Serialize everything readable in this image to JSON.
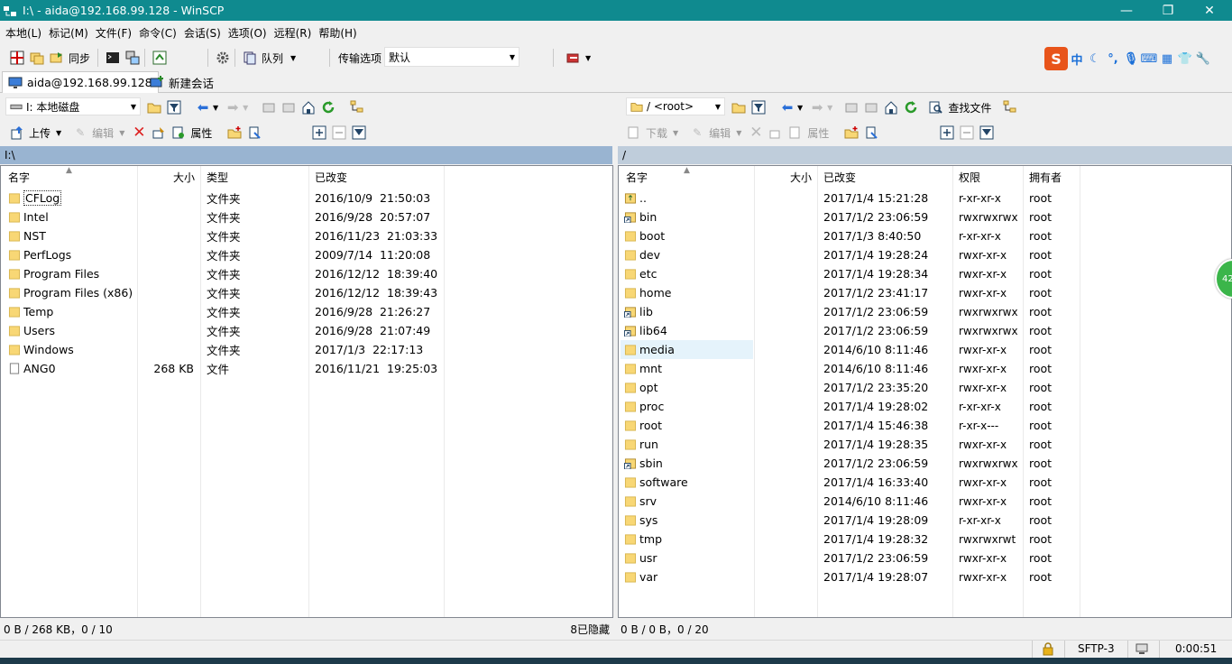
{
  "window": {
    "title": "I:\\ - aida@192.168.99.128 - WinSCP",
    "controls": {
      "minimize": "—",
      "restore": "❐",
      "close": "✕"
    }
  },
  "menu": [
    "本地(L)",
    "标记(M)",
    "文件(F)",
    "命令(C)",
    "会话(S)",
    "选项(O)",
    "远程(R)",
    "帮助(H)"
  ],
  "toolbar": {
    "sync_label": "同步",
    "queue_label": "队列",
    "transfer_options_label": "传输选项",
    "transfer_preset": "默认"
  },
  "ime": {
    "zh": "中"
  },
  "tabs": [
    {
      "label": "aida@192.168.99.128"
    },
    {
      "label": "新建会话"
    }
  ],
  "left": {
    "drive": "I: 本地磁盘",
    "upload_label": "上传",
    "edit_label": "编辑",
    "properties_label": "属性",
    "path": "I:\\",
    "columns": {
      "name": "名字",
      "size": "大小",
      "type": "类型",
      "changed": "已改变"
    },
    "files": [
      {
        "name": "CFLog",
        "size": "",
        "type": "文件夹",
        "changed": "2016/10/9  21:50:03",
        "kind": "folder"
      },
      {
        "name": "Intel",
        "size": "",
        "type": "文件夹",
        "changed": "2016/9/28  20:57:07",
        "kind": "folder"
      },
      {
        "name": "NST",
        "size": "",
        "type": "文件夹",
        "changed": "2016/11/23  21:03:33",
        "kind": "folder"
      },
      {
        "name": "PerfLogs",
        "size": "",
        "type": "文件夹",
        "changed": "2009/7/14  11:20:08",
        "kind": "folder"
      },
      {
        "name": "Program Files",
        "size": "",
        "type": "文件夹",
        "changed": "2016/12/12  18:39:40",
        "kind": "folder"
      },
      {
        "name": "Program Files (x86)",
        "size": "",
        "type": "文件夹",
        "changed": "2016/12/12  18:39:43",
        "kind": "folder"
      },
      {
        "name": "Temp",
        "size": "",
        "type": "文件夹",
        "changed": "2016/9/28  21:26:27",
        "kind": "folder"
      },
      {
        "name": "Users",
        "size": "",
        "type": "文件夹",
        "changed": "2016/9/28  21:07:49",
        "kind": "folder"
      },
      {
        "name": "Windows",
        "size": "",
        "type": "文件夹",
        "changed": "2017/1/3  22:17:13",
        "kind": "folder"
      },
      {
        "name": "ANG0",
        "size": "268 KB",
        "type": "文件",
        "changed": "2016/11/21  19:25:03",
        "kind": "file"
      }
    ],
    "status": "0 B / 268 KB，0 / 10",
    "hidden": "8已隐藏"
  },
  "right": {
    "path_select": "/ <root>",
    "find_files_label": "查找文件",
    "download_label": "下载",
    "edit_label": "编辑",
    "properties_label": "属性",
    "path": "/",
    "columns": {
      "name": "名字",
      "size": "大小",
      "changed": "已改变",
      "rights": "权限",
      "owner": "拥有者"
    },
    "files": [
      {
        "name": "..",
        "changed": "2017/1/4 15:21:28",
        "rights": "r-xr-xr-x",
        "owner": "root",
        "kind": "up"
      },
      {
        "name": "bin",
        "changed": "2017/1/2 23:06:59",
        "rights": "rwxrwxrwx",
        "owner": "root",
        "kind": "link"
      },
      {
        "name": "boot",
        "changed": "2017/1/3 8:40:50",
        "rights": "r-xr-xr-x",
        "owner": "root",
        "kind": "folder"
      },
      {
        "name": "dev",
        "changed": "2017/1/4 19:28:24",
        "rights": "rwxr-xr-x",
        "owner": "root",
        "kind": "folder"
      },
      {
        "name": "etc",
        "changed": "2017/1/4 19:28:34",
        "rights": "rwxr-xr-x",
        "owner": "root",
        "kind": "folder"
      },
      {
        "name": "home",
        "changed": "2017/1/2 23:41:17",
        "rights": "rwxr-xr-x",
        "owner": "root",
        "kind": "folder"
      },
      {
        "name": "lib",
        "changed": "2017/1/2 23:06:59",
        "rights": "rwxrwxrwx",
        "owner": "root",
        "kind": "link"
      },
      {
        "name": "lib64",
        "changed": "2017/1/2 23:06:59",
        "rights": "rwxrwxrwx",
        "owner": "root",
        "kind": "link"
      },
      {
        "name": "media",
        "changed": "2014/6/10 8:11:46",
        "rights": "rwxr-xr-x",
        "owner": "root",
        "kind": "folder",
        "hover": true
      },
      {
        "name": "mnt",
        "changed": "2014/6/10 8:11:46",
        "rights": "rwxr-xr-x",
        "owner": "root",
        "kind": "folder"
      },
      {
        "name": "opt",
        "changed": "2017/1/2 23:35:20",
        "rights": "rwxr-xr-x",
        "owner": "root",
        "kind": "folder"
      },
      {
        "name": "proc",
        "changed": "2017/1/4 19:28:02",
        "rights": "r-xr-xr-x",
        "owner": "root",
        "kind": "folder"
      },
      {
        "name": "root",
        "changed": "2017/1/4 15:46:38",
        "rights": "r-xr-x---",
        "owner": "root",
        "kind": "folder"
      },
      {
        "name": "run",
        "changed": "2017/1/4 19:28:35",
        "rights": "rwxr-xr-x",
        "owner": "root",
        "kind": "folder"
      },
      {
        "name": "sbin",
        "changed": "2017/1/2 23:06:59",
        "rights": "rwxrwxrwx",
        "owner": "root",
        "kind": "link"
      },
      {
        "name": "software",
        "changed": "2017/1/4 16:33:40",
        "rights": "rwxr-xr-x",
        "owner": "root",
        "kind": "folder"
      },
      {
        "name": "srv",
        "changed": "2014/6/10 8:11:46",
        "rights": "rwxr-xr-x",
        "owner": "root",
        "kind": "folder"
      },
      {
        "name": "sys",
        "changed": "2017/1/4 19:28:09",
        "rights": "r-xr-xr-x",
        "owner": "root",
        "kind": "folder"
      },
      {
        "name": "tmp",
        "changed": "2017/1/4 19:28:32",
        "rights": "rwxrwxrwt",
        "owner": "root",
        "kind": "folder"
      },
      {
        "name": "usr",
        "changed": "2017/1/2 23:06:59",
        "rights": "rwxr-xr-x",
        "owner": "root",
        "kind": "folder"
      },
      {
        "name": "var",
        "changed": "2017/1/4 19:28:07",
        "rights": "rwxr-xr-x",
        "owner": "root",
        "kind": "folder"
      }
    ],
    "status": "0 B / 0 B，0 / 20"
  },
  "bottom": {
    "protocol": "SFTP-3",
    "elapsed": "0:00:51"
  },
  "bubble": {
    "text": "42"
  },
  "colors": {
    "titlebar": "#0f8a8f",
    "active_path": "#99b4d1",
    "inactive_path": "#bfcddb",
    "folder": "#f8d775",
    "hover_row": "#e5f3fb"
  }
}
